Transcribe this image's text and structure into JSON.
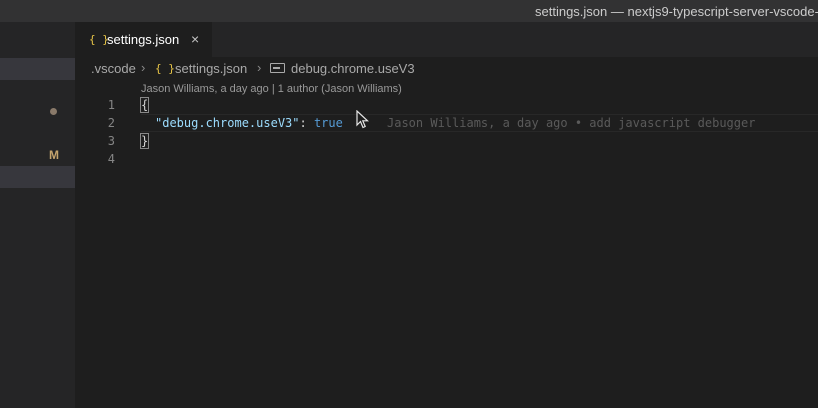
{
  "window": {
    "title": "settings.json — nextjs9-typescript-server-vscode-"
  },
  "sidebar": {
    "badge": "M"
  },
  "tab": {
    "label": "settings.json",
    "icon": "{ }"
  },
  "breadcrumb": {
    "folder": ".vscode",
    "file": "settings.json",
    "property": "debug.chrome.useV3"
  },
  "codelens": "Jason Williams, a day ago | 1 author (Jason Williams)",
  "editor": {
    "line_numbers": [
      "1",
      "2",
      "3",
      "4"
    ],
    "open_brace": "{",
    "key": "\"debug.chrome.useV3\"",
    "colon": ": ",
    "value": "true",
    "close_brace": "}",
    "blame": "Jason Williams, a day ago • add javascript debugger"
  },
  "colors": {
    "json_icon": "#e8c547",
    "key": "#9cdcfe",
    "keyword": "#569cd6",
    "modified": "#c5a46e"
  }
}
